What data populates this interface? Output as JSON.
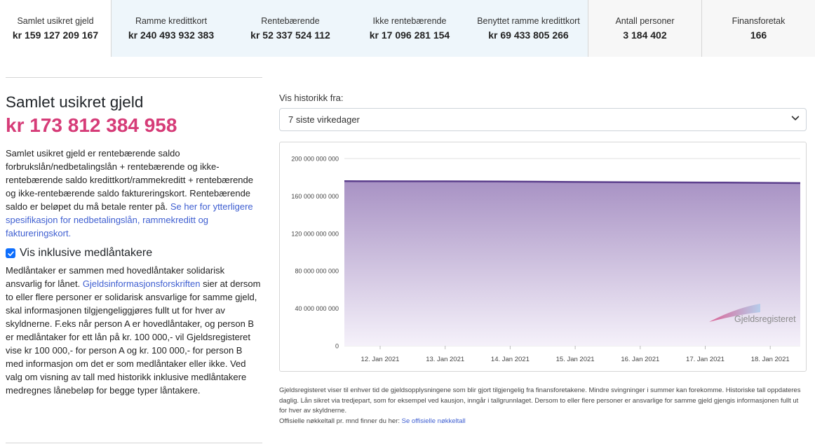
{
  "stats": [
    {
      "label": "Samlet usikret gjeld",
      "value": "kr 159 127 209 167"
    },
    {
      "label": "Ramme kredittkort",
      "value": "kr 240 493 932 383"
    },
    {
      "label": "Rentebærende",
      "value": "kr 52 337 524 112"
    },
    {
      "label": "Ikke rentebærende",
      "value": "kr 17 096 281 154"
    },
    {
      "label": "Benyttet ramme kredittkort",
      "value": "kr 69 433 805 266"
    },
    {
      "label": "Antall personer",
      "value": "3 184 402"
    },
    {
      "label": "Finansforetak",
      "value": "166"
    }
  ],
  "summary": {
    "title": "Samlet usikret gjeld",
    "value": "kr 173 812 384 958",
    "description": "Samlet usikret gjeld er rentebærende saldo forbrukslån/nedbetalingslån + rentebærende og ikke-rentebærende saldo kredittkort/rammekreditt + rentebærende og ikke-rentebærende saldo faktureringskort. Rentebærende saldo er beløpet du må betale renter på. ",
    "link": "Se her for ytterligere spesifikasjon for nedbetalingslån, rammekreditt og faktureringskort."
  },
  "coborrower": {
    "checkbox_label": "Vis inklusive medlåntakere",
    "checked": true,
    "text_before": "Medlåntaker er sammen med hovedlåntaker solidarisk ansvarlig for lånet. ",
    "link": "Gjeldsinformasjonsforskriften",
    "text_after": " sier at dersom to eller flere personer er solidarisk ansvarlige for samme gjeld, skal informasjonen tilgjengeliggjøres fullt ut for hver av skyldnerne. F.eks når person A er hovedlåntaker, og person B er medlåntaker for ett lån på kr. 100 000,- vil Gjeldsregisteret vise kr 100 000,- for person A og kr. 100 000,- for person B med informasjon om det er som medlåntaker eller ikke. Ved valg om visning av tall med historikk inklusive medlåntakere medregnes lånebeløp for begge typer låntakere."
  },
  "history": {
    "label": "Vis historikk fra:",
    "selected": "7 siste virkedager"
  },
  "chart_data": {
    "type": "area",
    "categories": [
      "12. Jan 2021",
      "13. Jan 2021",
      "14. Jan 2021",
      "15. Jan 2021",
      "16. Jan 2021",
      "17. Jan 2021",
      "18. Jan 2021"
    ],
    "values": [
      175800000000,
      175700000000,
      175500000000,
      175000000000,
      174600000000,
      174300000000,
      173812384958
    ],
    "y_ticks": [
      "200 000 000 000",
      "160 000 000 000",
      "120 000 000 000",
      "80 000 000 000",
      "40 000 000 000",
      "0"
    ],
    "ylim": [
      0,
      200000000000
    ],
    "grid": true,
    "line_color": "#5b3e8c",
    "fill_top_color": "#a892c4",
    "fill_bottom_color": "#f5f1fa"
  },
  "watermark": {
    "text": "Gjeldsregisteret"
  },
  "footnote": {
    "text": "Gjeldsregisteret viser til enhver tid de gjeldsopplysningene som blir gjort tilgjengelig fra finansforetakene. Mindre svingninger i summer kan forekomme. Historiske tall oppdateres daglig. Lån sikret via tredjepart, som for eksempel ved kausjon, inngår i tallgrunnlaget. Dersom to eller flere personer er ansvarlige for samme gjeld gjengis informasjonen fullt ut for hver av skyldnerne.",
    "link_prefix": "Offisielle nøkkeltall pr. mnd finner du her: ",
    "link": "Se offisielle nøkkeltall"
  },
  "colors": {
    "accent": "#d63c78",
    "link": "#3f5fd1",
    "checkbox": "#0d6efd"
  },
  "icons": {
    "checkbox": "check-icon",
    "dropdown": "chevron-down-icon"
  }
}
